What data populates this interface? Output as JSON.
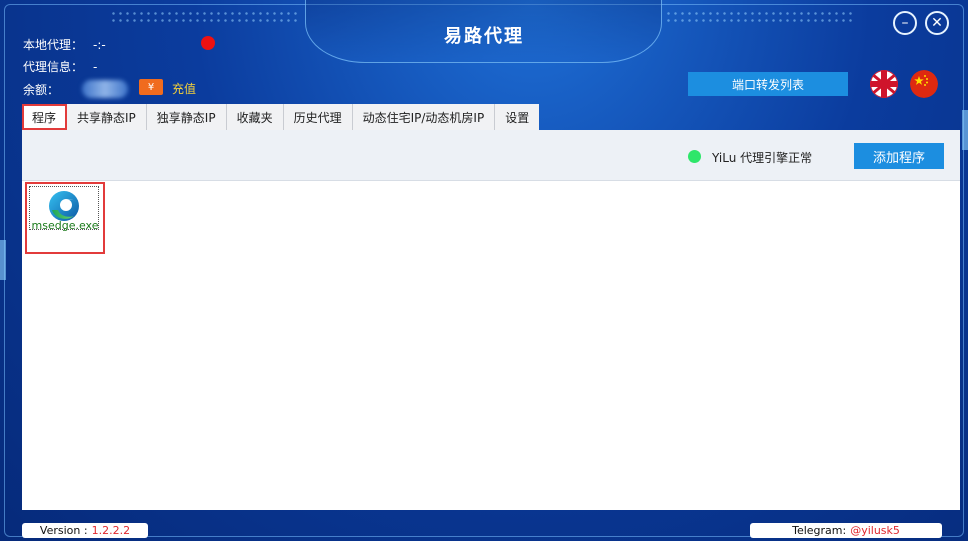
{
  "window": {
    "title": "易路代理"
  },
  "info": {
    "local_proxy_label": "本地代理：",
    "local_proxy_value": "-:-",
    "proxy_info_label": "代理信息：",
    "proxy_info_value": "-",
    "balance_label": "余额：",
    "recharge_label": "充值",
    "coupon_symbol": "¥"
  },
  "header_buttons": {
    "port_forward_label": "端口转发列表"
  },
  "tabs": [
    {
      "label": "程序",
      "active": true
    },
    {
      "label": "共享静态IP"
    },
    {
      "label": "独享静态IP"
    },
    {
      "label": "收藏夹"
    },
    {
      "label": "历史代理"
    },
    {
      "label": "动态住宅IP/动态机房IP"
    },
    {
      "label": "设置"
    }
  ],
  "toolbar": {
    "status_text": "YiLu 代理引擎正常",
    "add_program_label": "添加程序"
  },
  "programs": [
    {
      "name": "msedge.exe",
      "icon": "edge-icon"
    }
  ],
  "footer": {
    "version_label": "Version :",
    "version_value": "1.2.2.2",
    "telegram_label": "Telegram:",
    "telegram_value": "@yilusk5"
  },
  "colors": {
    "accent": "#1c8ee0",
    "highlight_outline": "#e23b3b",
    "status_ok": "#2ee66a",
    "recharge": "#f5d13a"
  }
}
